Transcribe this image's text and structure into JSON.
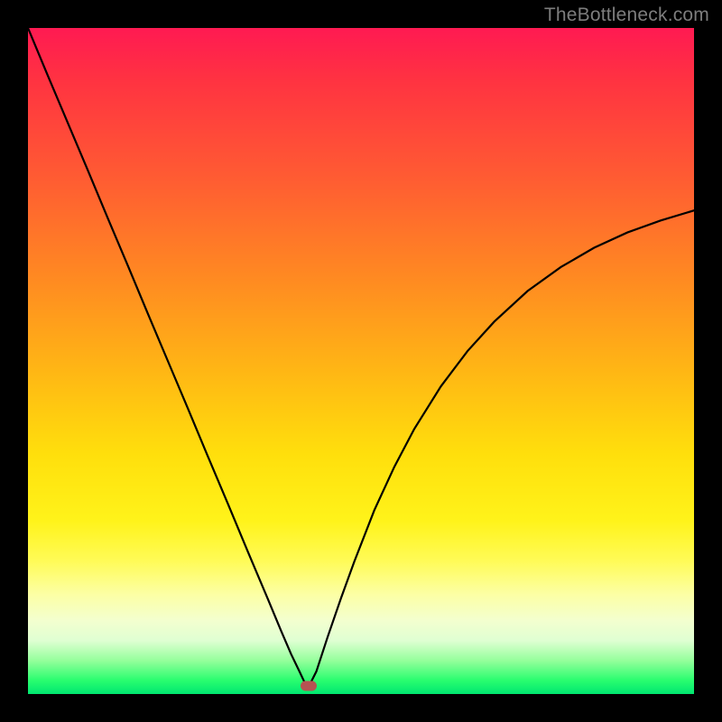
{
  "watermark": "TheBottleneck.com",
  "marker": {
    "x_pct": 42.1,
    "y_pct": 98.8,
    "color": "#b65252"
  },
  "colors": {
    "background": "#000000",
    "gradient_top": "#ff1a52",
    "gradient_bottom": "#00e670",
    "curve": "#000000",
    "watermark": "#7d7d7d"
  },
  "chart_data": {
    "type": "line",
    "title": "",
    "xlabel": "",
    "ylabel": "",
    "xlim": [
      0,
      100
    ],
    "ylim": [
      0,
      100
    ],
    "grid": false,
    "legend": false,
    "notes": "Axes unlabeled; units unknown. x and y are percentages of the plot area (origin at bottom-left). Values are read off pixel positions.",
    "series": [
      {
        "name": "left-branch",
        "x": [
          0,
          3,
          6,
          9,
          12,
          15,
          18,
          21,
          24,
          27,
          30,
          33,
          36,
          38,
          39.5,
          40.8,
          41.6,
          42.1
        ],
        "y": [
          100,
          92.8,
          85.7,
          78.6,
          71.4,
          64.3,
          57.1,
          50.0,
          42.9,
          35.7,
          28.6,
          21.4,
          14.3,
          9.5,
          6.0,
          3.3,
          1.6,
          1.0
        ]
      },
      {
        "name": "right-branch",
        "x": [
          42.1,
          43.3,
          45,
          47,
          49,
          52,
          55,
          58,
          62,
          66,
          70,
          75,
          80,
          85,
          90,
          95,
          100
        ],
        "y": [
          1.0,
          3.4,
          8.6,
          14.4,
          19.9,
          27.6,
          34.1,
          39.8,
          46.2,
          51.5,
          55.9,
          60.5,
          64.1,
          67.0,
          69.3,
          71.1,
          72.6
        ]
      }
    ],
    "marker_point": {
      "x": 42.1,
      "y": 1.2
    }
  }
}
